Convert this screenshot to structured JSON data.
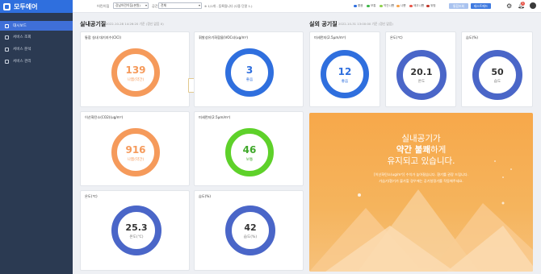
{
  "app": {
    "title": "모두에어"
  },
  "sidebar": {
    "items": [
      {
        "label": "대시보드",
        "active": true
      },
      {
        "label": "서비스 조회",
        "active": false
      },
      {
        "label": "서비스 분석",
        "active": false
      },
      {
        "label": "서비스 관리",
        "active": false
      }
    ]
  },
  "topbar": {
    "location_label": "어린이집",
    "location_value": "강남어린이집(본원)",
    "space_label": "공간",
    "space_value": "전체",
    "selected_note": "※ 1/1개 - 등록됩니다 (나중 단말 1.)",
    "legend": [
      {
        "label": "좋음",
        "color": "#2f6fde"
      },
      {
        "label": "보통",
        "color": "#3fb64a"
      },
      {
        "label": "약간나쁨",
        "color": "#8fd14f"
      },
      {
        "label": "나쁨",
        "color": "#f6a24b"
      },
      {
        "label": "매우나쁨",
        "color": "#e8564a"
      },
      {
        "label": "위험",
        "color": "#c0392b"
      }
    ],
    "btn_primary": "통합조회",
    "btn_secondary": "테스트패드",
    "notification_count": "1"
  },
  "indoor": {
    "title": "실내공기질",
    "timestamp": "2022-10-28 14:26:20 기준 (갱신 없음 X)",
    "cards": [
      {
        "title": "통합 실내 대기지수(CICI)",
        "value": "139",
        "status": "나쁨(약간)",
        "color": "#f59a5b"
      },
      {
        "title": "휘발성유기화합물(VOCs)(ug/m³)",
        "value": "3",
        "status": "좋음",
        "color": "#2f6fde"
      },
      {
        "title": "이산화탄소(CO2)(ug/m³)",
        "value": "916",
        "status": "나쁨(약간)",
        "color": "#f59a5b"
      },
      {
        "title": "미세먼지(2.5μm/m³)",
        "value": "46",
        "status": "보통",
        "color": "#5ed12a"
      },
      {
        "title": "온도(℃)",
        "value": "25.3",
        "status": "온도(℃)",
        "color": "#4a66c8"
      },
      {
        "title": "습도(%)",
        "value": "42",
        "status": "습도(%)",
        "color": "#4a66c8"
      }
    ]
  },
  "outdoor": {
    "title": "실외 공기질",
    "timestamp": "2022-10-31 13:00:00 기준 (갱신 없음)",
    "cards": [
      {
        "title": "미세먼지(2.5μm/m³)",
        "value": "12",
        "status": "좋음",
        "color": "#2f6fde"
      },
      {
        "title": "온도(℃)",
        "value": "20.1",
        "status": "온도",
        "color": "#4a66c8"
      },
      {
        "title": "습도(%)",
        "value": "50",
        "status": "습도",
        "color": "#4a66c8"
      }
    ]
  },
  "banner": {
    "line1": "실내공기가",
    "line2_strong": "약간 불쾌",
    "line2_rest": "하게",
    "line3": "유지되고 있습니다.",
    "sub1": "[이산화탄소(ug/m³)] 수치가 높아졌습니다. 환기를 권장 드립니다.",
    "sub2": "가습기/환기가 불가할 경우에는 공기청정기를 작동해주세요."
  }
}
